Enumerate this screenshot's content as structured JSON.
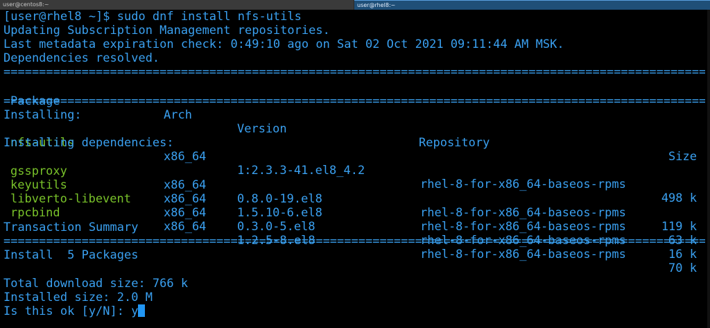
{
  "tabs": [
    {
      "title": "user@centos8:~",
      "active": false
    },
    {
      "title": "user@rhel8:~",
      "active": true
    }
  ],
  "terminal": {
    "prompt": "[user@rhel8 ~]$ sudo dnf install nfs-utils",
    "line_updating": "Updating Subscription Management repositories.",
    "line_metadata": "Last metadata expiration check: 0:49:10 ago on Sat 02 Oct 2021 09:11:44 AM MSK.",
    "line_resolved": "Dependencies resolved.",
    "rule": "================================================================================================================================",
    "headers": {
      "package": "Package",
      "arch": "Arch",
      "version": "Version",
      "repository": "Repository",
      "size": "Size"
    },
    "section_installing": "Installing:",
    "section_deps": "Installing dependencies:",
    "packages": [
      {
        "name": "nfs-utils",
        "arch": "x86_64",
        "version": "1:2.3.3-41.el8_4.2",
        "repo": "rhel-8-for-x86_64-baseos-rpms",
        "size": "498 k"
      },
      {
        "name": "gssproxy",
        "arch": "x86_64",
        "version": "0.8.0-19.el8",
        "repo": "rhel-8-for-x86_64-baseos-rpms",
        "size": "119 k"
      },
      {
        "name": "keyutils",
        "arch": "x86_64",
        "version": "1.5.10-6.el8",
        "repo": "rhel-8-for-x86_64-baseos-rpms",
        "size": "63 k"
      },
      {
        "name": "libverto-libevent",
        "arch": "x86_64",
        "version": "0.3.0-5.el8",
        "repo": "rhel-8-for-x86_64-baseos-rpms",
        "size": "16 k"
      },
      {
        "name": "rpcbind",
        "arch": "x86_64",
        "version": "1.2.5-8.el8",
        "repo": "rhel-8-for-x86_64-baseos-rpms",
        "size": "70 k"
      }
    ],
    "summary_title": "Transaction Summary",
    "install_count": "Install  5 Packages",
    "download_size": "Total download size: 766 k",
    "installed_size": "Installed size: 2.0 M",
    "confirm_prompt": "Is this ok [y/N]: ",
    "confirm_input": "y"
  },
  "colors": {
    "text": "#3aa0f0",
    "package_name": "#79c22a",
    "cursor": "#2196f3",
    "background": "#000000"
  }
}
